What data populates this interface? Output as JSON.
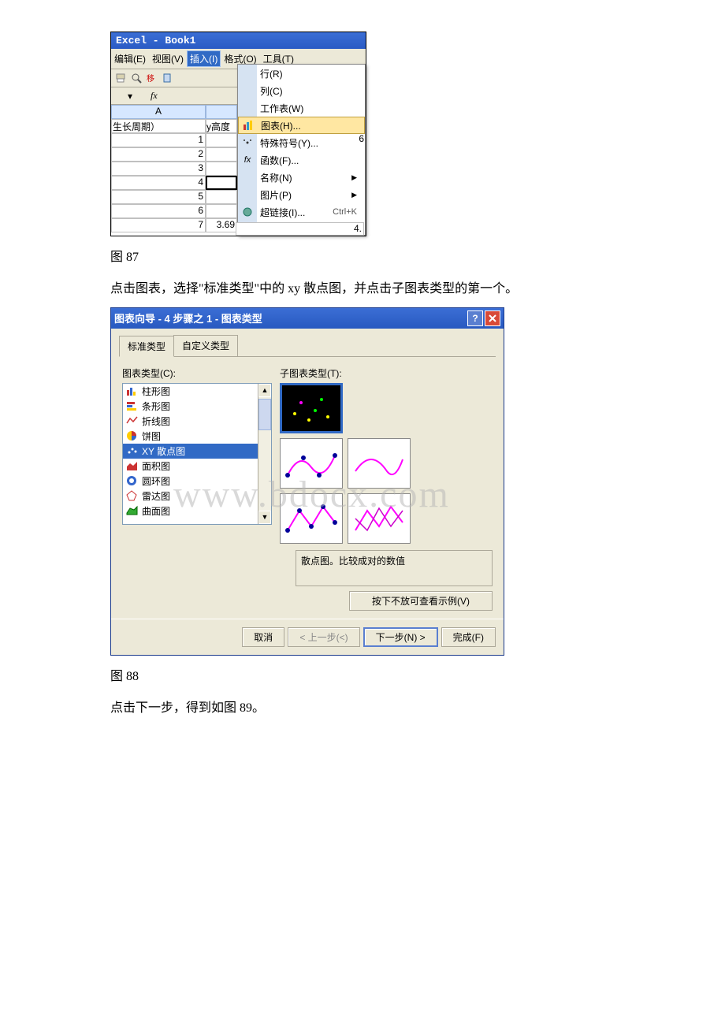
{
  "excel1": {
    "title": "Excel - Book1",
    "menus": {
      "edit": "编辑(E)",
      "view": "视图(V)",
      "insert": "插入(I)",
      "format": "格式(O)",
      "tools": "工具(T)"
    },
    "fx": "fx",
    "colA": "A",
    "leftHeader": "生长周期）",
    "colBHeader": "y高度",
    "rows": [
      "1",
      "2",
      "3",
      "4",
      "5",
      "6",
      "7"
    ],
    "dropdown": {
      "row": "行(R)",
      "col": "列(C)",
      "sheet": "工作表(W)",
      "chart": "图表(H)...",
      "symbol": "特殊符号(Y)...",
      "func": "函数(F)...",
      "name": "名称(N)",
      "pic": "图片(P)",
      "link": "超链接(I)...",
      "shortcut": "Ctrl+K"
    },
    "b7": "3.69",
    "c6float": "6",
    "c7float": "4."
  },
  "caption87": "图 87",
  "para1": "点击图表，选择\"标准类型\"中的 xy 散点图，并点击子图表类型的第一个。",
  "wizard": {
    "title": "图表向导 - 4 步骤之 1 - 图表类型",
    "tab1": "标准类型",
    "tab2": "自定义类型",
    "chartTypeLabel": "图表类型(C):",
    "subTypeLabel": "子图表类型(T):",
    "types": {
      "column": "柱形图",
      "bar": "条形图",
      "line": "折线图",
      "pie": "饼图",
      "scatter": "XY 散点图",
      "area": "面积图",
      "doughnut": "圆环图",
      "radar": "雷达图",
      "surface": "曲面图"
    },
    "desc": "散点图。比较成对的数值",
    "sampleBtn": "按下不放可查看示例(V)",
    "cancel": "取消",
    "back": "< 上一步(<)",
    "next": "下一步(N) >",
    "finish": "完成(F)"
  },
  "caption88": "图 88",
  "para2": "点击下一步，得到如图 89。"
}
